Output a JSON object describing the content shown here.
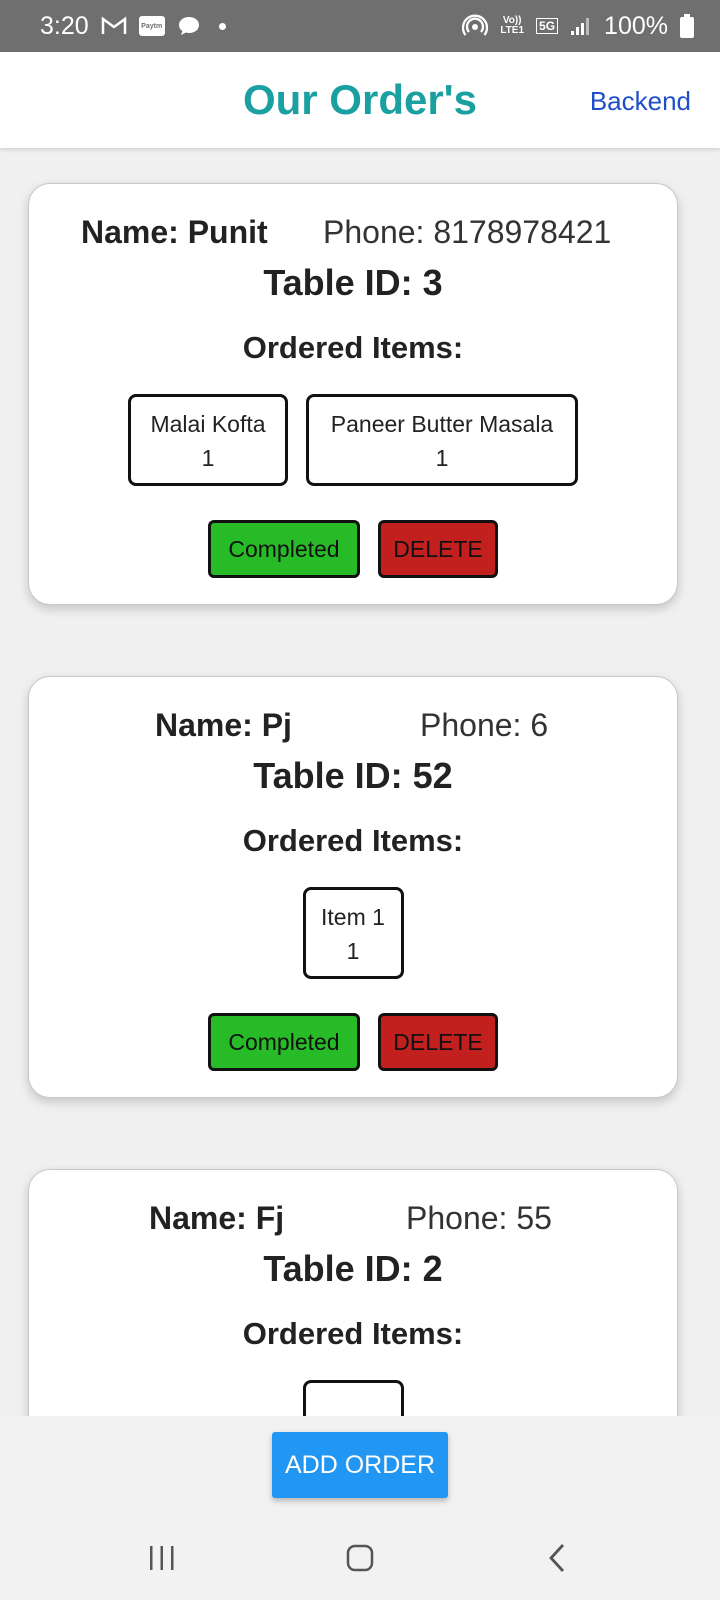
{
  "status_bar": {
    "time": "3:20",
    "network_top": "Vo))",
    "network_bottom": "LTE1",
    "network_type": "5G",
    "battery": "100%",
    "icons": [
      "gmail-icon",
      "paytm-icon",
      "chat-icon",
      "hotspot-icon",
      "signal-icon",
      "battery-icon"
    ],
    "paytm_text": "Paytm"
  },
  "header": {
    "title": "Our Order's",
    "backend_link": "Backend"
  },
  "orders": [
    {
      "name": "Name: Punit",
      "phone": "Phone: 8178978421",
      "table_id": "Table ID: 3",
      "ordered_label": "Ordered Items:",
      "items": [
        {
          "name": "Malai Kofta",
          "qty": "1"
        },
        {
          "name": "Paneer Butter Masala",
          "qty": "1"
        }
      ],
      "completed_label": "Completed",
      "delete_label": "DELETE"
    },
    {
      "name": "Name: Pj",
      "phone": "Phone: 6",
      "table_id": "Table ID: 52",
      "ordered_label": "Ordered Items:",
      "items": [
        {
          "name": "Item 1",
          "qty": "1"
        }
      ],
      "completed_label": "Completed",
      "delete_label": "DELETE"
    },
    {
      "name": "Name: Fj",
      "phone": "Phone: 55",
      "table_id": "Table ID: 2",
      "ordered_label": "Ordered Items:",
      "items": [],
      "completed_label": "",
      "delete_label": ""
    }
  ],
  "add_order_label": "ADD ORDER",
  "colors": {
    "title": "#1aa0a0",
    "link": "#1f4fc8",
    "completed": "#27bc27",
    "delete": "#c21f1f",
    "add_button": "#2196f3"
  }
}
